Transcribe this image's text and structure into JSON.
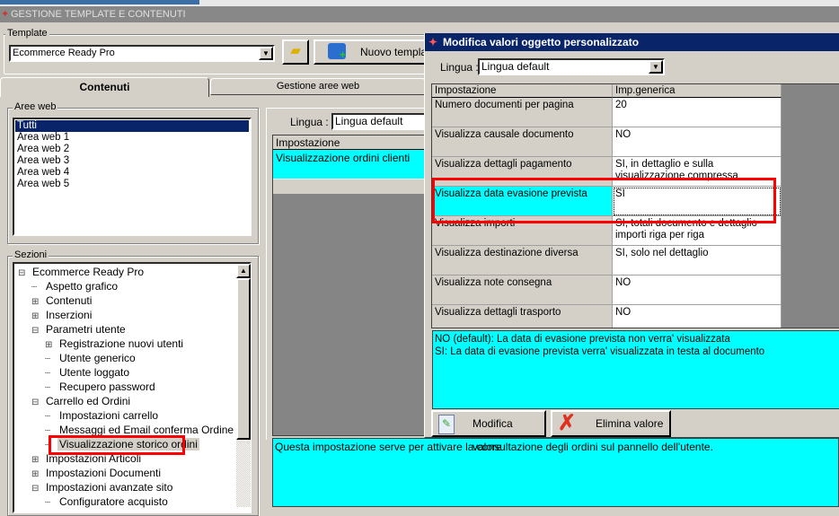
{
  "window": {
    "title": "GESTIONE TEMPLATE E CONTENUTI"
  },
  "template": {
    "group_label": "Template",
    "selected": "Ecommerce Ready Pro",
    "new_button": "Nuovo template"
  },
  "tabs": [
    {
      "label": "Contenuti",
      "active": true
    },
    {
      "label": "Gestione aree web",
      "active": false
    }
  ],
  "aree_web": {
    "label": "Aree web",
    "items": [
      "Tutti",
      "Area web 1",
      "Area web 2",
      "Area web 3",
      "Area web 4",
      "Area web 5"
    ],
    "selected": "Tutti"
  },
  "sezioni": {
    "label": "Sezioni",
    "tree": [
      {
        "label": "Ecommerce Ready Pro",
        "level": 0,
        "expander": "minus"
      },
      {
        "label": "Aspetto grafico",
        "level": 1,
        "expander": ""
      },
      {
        "label": "Contenuti",
        "level": 1,
        "expander": "plus"
      },
      {
        "label": "Inserzioni",
        "level": 1,
        "expander": "plus"
      },
      {
        "label": "Parametri utente",
        "level": 1,
        "expander": "minus"
      },
      {
        "label": "Registrazione nuovi utenti",
        "level": 2,
        "expander": "plus"
      },
      {
        "label": "Utente generico",
        "level": 2,
        "expander": ""
      },
      {
        "label": "Utente loggato",
        "level": 2,
        "expander": ""
      },
      {
        "label": "Recupero password",
        "level": 2,
        "expander": ""
      },
      {
        "label": "Carrello ed Ordini",
        "level": 1,
        "expander": "minus"
      },
      {
        "label": "Impostazioni carrello",
        "level": 2,
        "expander": ""
      },
      {
        "label": "Messaggi ed Email conferma Ordine",
        "level": 2,
        "expander": ""
      },
      {
        "label": "Visualizzazione storico ordini",
        "level": 2,
        "expander": "",
        "selected": true
      },
      {
        "label": "Impostazioni Articoli",
        "level": 1,
        "expander": "plus"
      },
      {
        "label": "Impostazioni Documenti",
        "level": 1,
        "expander": "plus"
      },
      {
        "label": "Impostazioni avanzate sito",
        "level": 1,
        "expander": "minus"
      },
      {
        "label": "Configuratore acquisto",
        "level": 2,
        "expander": ""
      }
    ]
  },
  "content": {
    "lingua_label": "Lingua :",
    "lingua_value": "Lingua default",
    "grid_header": "Impostazione",
    "grid_row": "Visualizzazione ordini clienti",
    "description": "Questa impostazione serve per attivare la consultazione degli ordini sul pannello dell'utente."
  },
  "dialog": {
    "title": "Modifica valori oggetto personalizzato",
    "lingua_label": "Lingua :",
    "lingua_value": "Lingua default",
    "columns": [
      "Impostazione",
      "Imp.generica"
    ],
    "rows": [
      {
        "name": "Numero documenti per pagina",
        "value": "20"
      },
      {
        "name": "Visualizza causale documento",
        "value": "NO"
      },
      {
        "name": "Visualizza dettagli pagamento",
        "value": "SI, in dettaglio e sulla visualizzazione compressa"
      },
      {
        "name": "Visualizza data evasione prevista",
        "value": "SI",
        "selected": true
      },
      {
        "name": "Visualizza importi",
        "value": "SI, totali documento e dettaglio importi riga per riga"
      },
      {
        "name": "Visualizza destinazione diversa",
        "value": "SI, solo nel dettaglio"
      },
      {
        "name": "Visualizza note consegna",
        "value": "NO"
      },
      {
        "name": "Visualizza dettagli trasporto",
        "value": "NO"
      }
    ],
    "help_lines": [
      "NO (default): La data di evasione prevista non verra' visualizzata",
      "SI: La data di evasione prevista verra' visualizzata in testa al documento"
    ],
    "edit_button": "Modifica valore",
    "delete_button": "Elimina valore"
  },
  "colors": {
    "selection_cyan": "#00ffff",
    "titlebar_navy": "#0a246a",
    "highlight_red": "#ff0000"
  }
}
